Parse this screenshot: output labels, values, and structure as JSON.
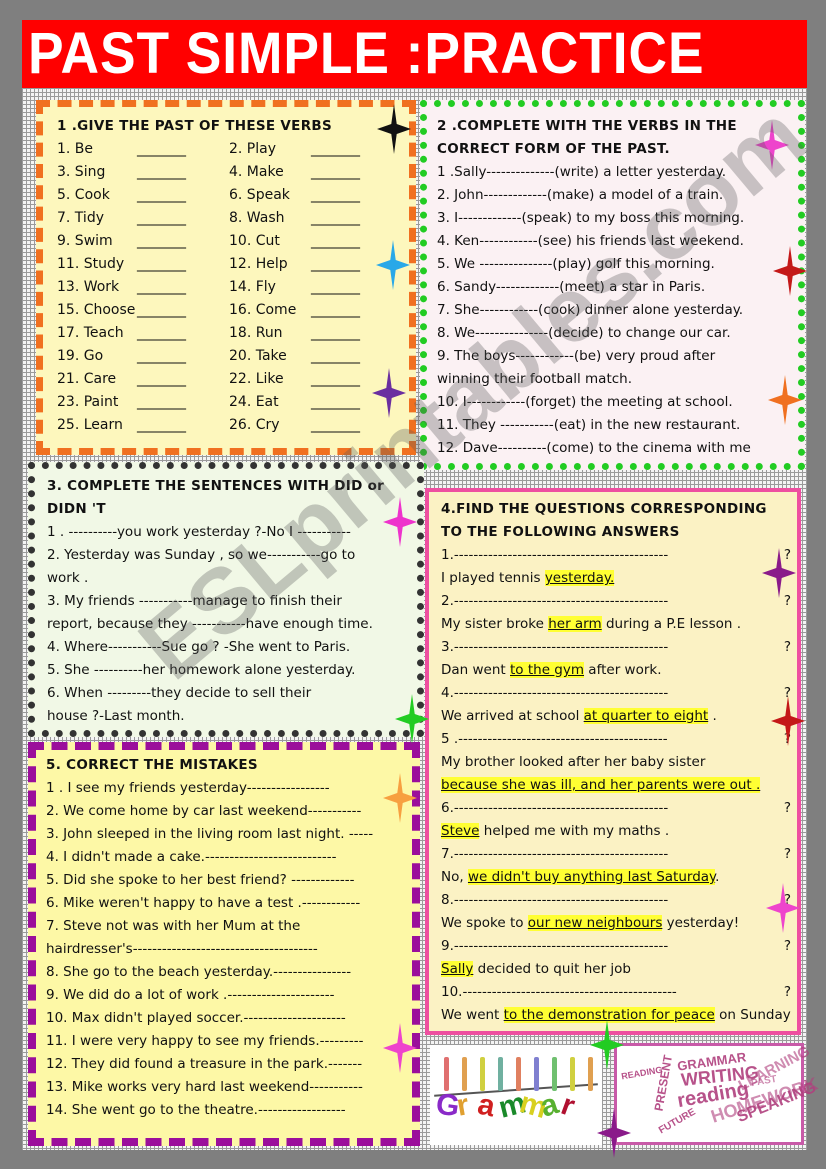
{
  "title": "PAST SIMPLE :PRACTICE",
  "colors": {
    "title_bg": "#ff0000",
    "box1_border": "#f07020",
    "box2_border": "#22cc22",
    "box3_border": "#333333",
    "box4_border": "#ee4fa0",
    "box5_border": "#9b0e9b",
    "highlight": "#ffff33"
  },
  "section1": {
    "heading": "1 .GIVE THE PAST OF THESE VERBS",
    "blank": "_______",
    "items": [
      "1. Be",
      "2. Play",
      "3. Sing",
      "4. Make",
      "5. Cook",
      "6. Speak",
      "7. Tidy",
      "8. Wash",
      "9. Swim",
      "10. Cut",
      "11. Study",
      "12. Help",
      "13. Work",
      "14. Fly",
      "15. Choose",
      "16. Come",
      "17. Teach",
      "18. Run",
      "19. Go",
      "20. Take",
      "21. Care",
      "22. Like",
      "23. Paint",
      "24. Eat",
      "25. Learn",
      "26. Cry"
    ]
  },
  "section2": {
    "heading_line1": "2 .COMPLETE WITH THE VERBS IN THE",
    "heading_line2": "CORRECT FORM  OF THE PAST.",
    "lines": [
      "1 .Sally--------------(write) a letter yesterday.",
      "2. John-------------(make) a model of a train.",
      "3. I-------------(speak) to my boss this morning.",
      "4. Ken------------(see) his friends last weekend.",
      "5. We ---------------(play) golf this morning.",
      "6. Sandy-------------(meet) a star in Paris.",
      "7. She------------(cook) dinner alone yesterday.",
      "8. We---------------(decide) to change our car.",
      "9. The boys------------(be) very proud after",
      "winning their football match.",
      "10. I------------(forget) the meeting at school.",
      "11. They -----------(eat) in the new restaurant.",
      "12. Dave----------(come) to the cinema with me"
    ]
  },
  "section3": {
    "heading_line1": "3. COMPLETE THE SENTENCES WITH DID or",
    "heading_line2": "DIDN 'T",
    "lines": [
      "1 . ----------you work yesterday ?-No I -----------",
      "2. Yesterday was Sunday , so we-----------go to",
      "work .",
      "3. My friends -----------manage to finish their",
      "report, because they -----------have enough time.",
      "4. Where-----------Sue go ? -She went to Paris.",
      "5. She ----------her homework alone yesterday.",
      "6. When ---------they decide to sell their",
      "house ?-Last month."
    ]
  },
  "section4": {
    "heading_line1": "4.FIND THE QUESTIONS CORRESPONDING",
    "heading_line2": "TO THE FOLLOWING ANSWERS",
    "items": [
      {
        "q": "1.--------------------------------------------",
        "qmark": "?",
        "pre": "I played tennis ",
        "hl": "yesterday.",
        "post": ""
      },
      {
        "q": "2.--------------------------------------------",
        "qmark": "?",
        "pre": "My sister broke ",
        "hl": "her arm",
        "post": " during a P.E lesson    ."
      },
      {
        "q": "3.--------------------------------------------",
        "qmark": "?",
        "pre": "Dan went  ",
        "hl": "to the gym",
        "post": " after work."
      },
      {
        "q": "4.--------------------------------------------",
        "qmark": "?",
        "pre": "We arrived at school ",
        "hl": "at quarter to eight",
        "post": "  ."
      },
      {
        "q": "5 .-------------------------------------------",
        "qmark": "?",
        "pre": "My brother looked after her baby sister",
        "hl": "",
        "post": ""
      },
      {
        "q": "",
        "qmark": "",
        "pre": "",
        "hl": "because she was ill, and her parents were out .",
        "post": ""
      },
      {
        "q": "6.--------------------------------------------",
        "qmark": "?",
        "pre": "",
        "hl": "Steve",
        "post": " helped me with my maths    ."
      },
      {
        "q": "7.--------------------------------------------",
        "qmark": "?",
        "pre": "No, ",
        "hl": "we didn't buy anything last Saturday",
        "post": "."
      },
      {
        "q": "8.--------------------------------------------",
        "qmark": "?",
        "pre": "We spoke to ",
        "hl": "our new neighbours",
        "post": " yesterday!"
      },
      {
        "q": "9.--------------------------------------------",
        "qmark": "?",
        "pre": "",
        "hl": "Sally",
        "post": " decided to quit her job"
      },
      {
        "q": "10.--------------------------------------------",
        "qmark": "?",
        "pre": "We went ",
        "hl": "to the demonstration for peace",
        "post": " on Sunday"
      }
    ]
  },
  "section5": {
    "heading": "5. CORRECT THE MISTAKES",
    "lines": [
      "1 . I see my friends yesterday-----------------",
      "2. We come home by car last weekend-----------",
      "3. John sleeped in the living room last night. -----",
      "4. I didn't made a cake.---------------------------",
      "5. Did she spoke to her best friend? -------------",
      "6. Mike weren't happy to have a test .------------",
      "7. Steve not was with her Mum at the",
      "hairdresser's--------------------------------------",
      "8. She go to the beach yesterday.----------------",
      "9. We did do a lot of work .----------------------",
      "10. Max didn't played soccer.---------------------",
      "11. I were very happy to see my friends.---------",
      "12. They did found a treasure in the park.-------",
      "13. Mike  works very hard last weekend-----------",
      "14. She went go to the theatre.------------------"
    ]
  },
  "images": {
    "grammar_letters": [
      "G",
      "r",
      "a",
      "m",
      "m",
      "a",
      "r"
    ],
    "word_cloud": [
      "GRAMMAR",
      "WRITING",
      "LEARNING",
      "reading",
      "PRESENT",
      "HOMEWORK",
      "SPEAKING",
      "READING",
      "PAST",
      "FUTURE"
    ]
  },
  "watermark": "ESLprintables.com"
}
